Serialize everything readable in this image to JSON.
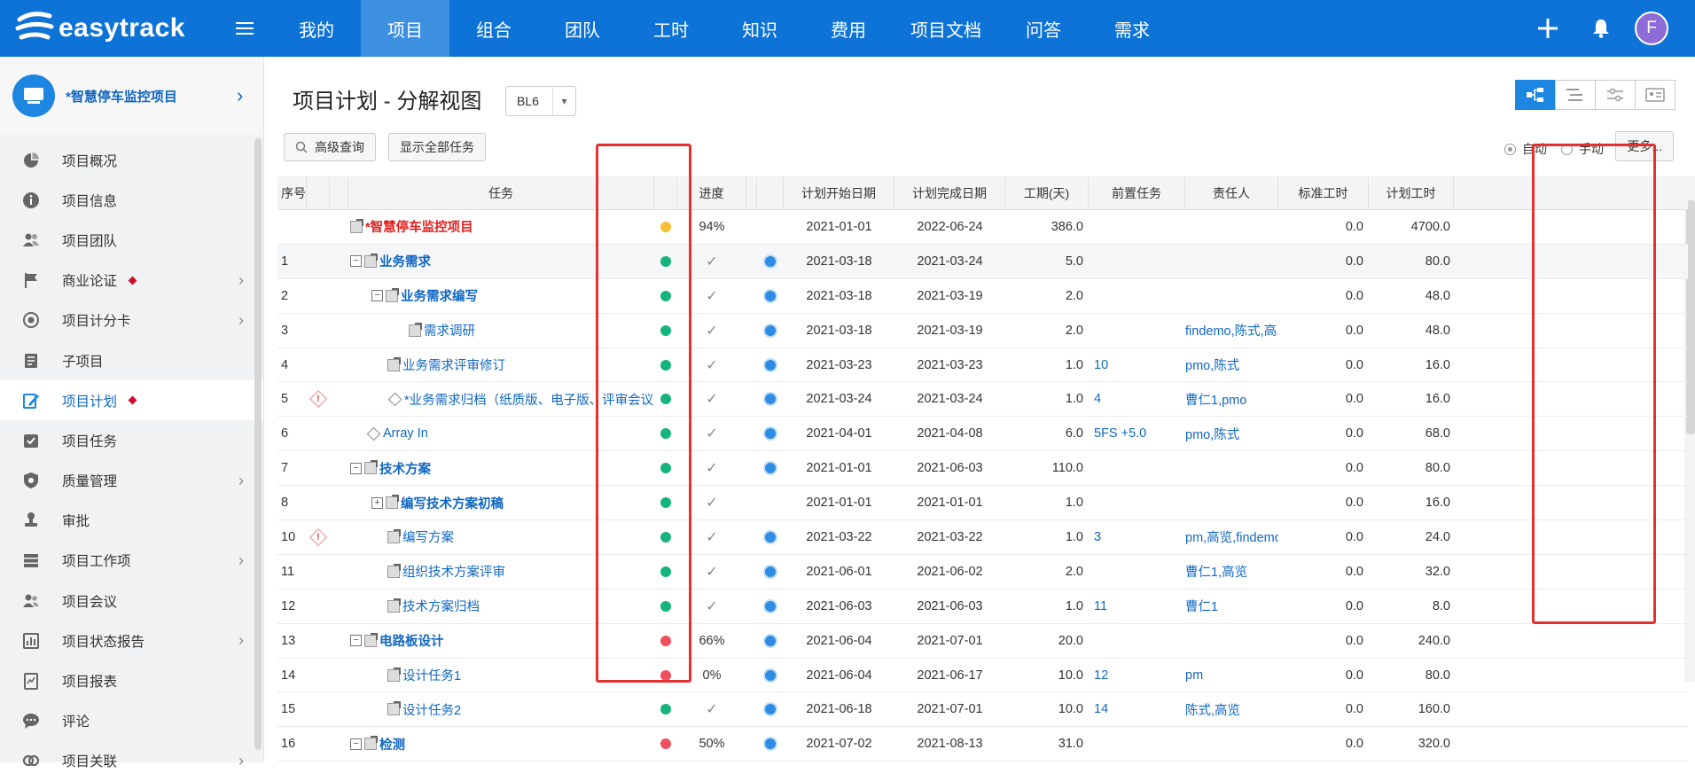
{
  "app": {
    "brand": "easytrack",
    "avatar_letter": "F"
  },
  "nav": [
    "我的",
    "项目",
    "组合",
    "团队",
    "工时",
    "知识",
    "费用",
    "项目文档",
    "问答",
    "需求"
  ],
  "nav_active": 1,
  "project": {
    "name": "*智慧停车监控项目"
  },
  "sidebar": [
    {
      "label": "项目概况",
      "icon": "pie-chart-icon"
    },
    {
      "label": "项目信息",
      "icon": "info-icon"
    },
    {
      "label": "项目团队",
      "icon": "team-icon"
    },
    {
      "label": "商业论证",
      "icon": "flag-icon",
      "chevron": true,
      "dot": true
    },
    {
      "label": "项目计分卡",
      "icon": "target-icon",
      "chevron": true
    },
    {
      "label": "子项目",
      "icon": "document-icon"
    },
    {
      "label": "项目计划",
      "icon": "edit-plan-icon",
      "dot": true,
      "active": true
    },
    {
      "label": "项目任务",
      "icon": "task-check-icon"
    },
    {
      "label": "质量管理",
      "icon": "shield-icon",
      "chevron": true
    },
    {
      "label": "审批",
      "icon": "stamp-icon"
    },
    {
      "label": "项目工作项",
      "icon": "stack-icon",
      "chevron": true
    },
    {
      "label": "项目会议",
      "icon": "meeting-icon"
    },
    {
      "label": "项目状态报告",
      "icon": "bar-report-icon",
      "chevron": true
    },
    {
      "label": "项目报表",
      "icon": "chart-report-icon"
    },
    {
      "label": "评论",
      "icon": "comment-icon"
    },
    {
      "label": "项目关联",
      "icon": "link-icon",
      "chevron": true
    }
  ],
  "page": {
    "title": "项目计划 - 分解视图",
    "baseline": "BL6",
    "advanced_search": "高级查询",
    "show_all": "显示全部任务",
    "mode_auto": "自动",
    "mode_manual": "手动",
    "more": "更多..."
  },
  "table": {
    "headers": {
      "seq": "序号",
      "task": "任务",
      "progress": "进度",
      "start": "计划开始日期",
      "end": "计划完成日期",
      "duration": "工期(天)",
      "predecessor": "前置任务",
      "owner": "责任人",
      "std_hours": "标准工时",
      "plan_hours": "计划工时"
    },
    "rows": [
      {
        "seq": "",
        "level": 0,
        "name": "*智慧停车监控项目",
        "kind": "root",
        "status": "yellow",
        "progress": "94%",
        "type_icon": false,
        "start": "2021-01-01",
        "end": "2022-06-24",
        "duration": "386.0",
        "pred": "",
        "owner": "",
        "std": "0.0",
        "plan": "4700.0"
      },
      {
        "seq": "1",
        "level": 1,
        "name": "业务需求",
        "kind": "group",
        "tree": "minus",
        "status": "green",
        "progress": "✓",
        "type_icon": true,
        "start": "2021-03-18",
        "end": "2021-03-24",
        "duration": "5.0",
        "pred": "",
        "owner": "",
        "std": "0.0",
        "plan": "80.0",
        "alt": true
      },
      {
        "seq": "2",
        "level": 2,
        "name": "业务需求编写",
        "kind": "group",
        "tree": "minus",
        "status": "green",
        "progress": "✓",
        "type_icon": true,
        "start": "2021-03-18",
        "end": "2021-03-19",
        "duration": "2.0",
        "pred": "",
        "owner": "",
        "std": "0.0",
        "plan": "48.0"
      },
      {
        "seq": "3",
        "level": 3,
        "name": "需求调研",
        "kind": "task",
        "status": "green",
        "progress": "✓",
        "type_icon": true,
        "start": "2021-03-18",
        "end": "2021-03-19",
        "duration": "2.0",
        "pred": "",
        "owner": "findemo,陈式,高...",
        "std": "0.0",
        "plan": "48.0"
      },
      {
        "seq": "4",
        "level": 2,
        "name": "业务需求评审修订",
        "kind": "task",
        "status": "green",
        "progress": "✓",
        "type_icon": true,
        "start": "2021-03-23",
        "end": "2021-03-23",
        "duration": "1.0",
        "pred": "10",
        "owner": "pmo,陈式",
        "std": "0.0",
        "plan": "16.0"
      },
      {
        "seq": "5",
        "level": 2,
        "name": "*业务需求归档（纸质版、电子版、评审会议纪",
        "kind": "milestone",
        "warn": true,
        "status": "green",
        "progress": "✓",
        "type_icon": true,
        "start": "2021-03-24",
        "end": "2021-03-24",
        "duration": "1.0",
        "pred": "4",
        "owner": "曹仁1,pmo",
        "std": "0.0",
        "plan": "16.0"
      },
      {
        "seq": "6",
        "level": 1,
        "name": "Array In",
        "kind": "milestone",
        "status": "green",
        "progress": "✓",
        "type_icon": true,
        "start": "2021-04-01",
        "end": "2021-04-08",
        "duration": "6.0",
        "pred": "5FS +5.0",
        "owner": "pmo,陈式",
        "std": "0.0",
        "plan": "68.0"
      },
      {
        "seq": "7",
        "level": 1,
        "name": "技术方案",
        "kind": "group",
        "tree": "minus",
        "status": "green",
        "progress": "✓",
        "type_icon": true,
        "start": "2021-01-01",
        "end": "2021-06-03",
        "duration": "110.0",
        "pred": "",
        "owner": "",
        "std": "0.0",
        "plan": "80.0"
      },
      {
        "seq": "8",
        "level": 2,
        "name": "编写技术方案初稿",
        "kind": "group",
        "tree": "plus",
        "status": "green",
        "progress": "✓",
        "type_icon": false,
        "start": "2021-01-01",
        "end": "2021-01-01",
        "duration": "1.0",
        "pred": "",
        "owner": "",
        "std": "0.0",
        "plan": "16.0"
      },
      {
        "seq": "10",
        "level": 2,
        "name": "编写方案",
        "kind": "task",
        "warn": true,
        "status": "green",
        "progress": "✓",
        "type_icon": true,
        "start": "2021-03-22",
        "end": "2021-03-22",
        "duration": "1.0",
        "pred": "3",
        "owner": "pm,高览,findemo",
        "std": "0.0",
        "plan": "24.0"
      },
      {
        "seq": "11",
        "level": 2,
        "name": "组织技术方案评审",
        "kind": "task",
        "status": "green",
        "progress": "✓",
        "type_icon": true,
        "start": "2021-06-01",
        "end": "2021-06-02",
        "duration": "2.0",
        "pred": "",
        "owner": "曹仁1,高览",
        "std": "0.0",
        "plan": "32.0"
      },
      {
        "seq": "12",
        "level": 2,
        "name": "技术方案归档",
        "kind": "task",
        "status": "green",
        "progress": "✓",
        "type_icon": true,
        "start": "2021-06-03",
        "end": "2021-06-03",
        "duration": "1.0",
        "pred": "11",
        "owner": "曹仁1",
        "std": "0.0",
        "plan": "8.0"
      },
      {
        "seq": "13",
        "level": 1,
        "name": "电路板设计",
        "kind": "group",
        "tree": "minus",
        "status": "red",
        "progress": "66%",
        "type_icon": true,
        "start": "2021-06-04",
        "end": "2021-07-01",
        "duration": "20.0",
        "pred": "",
        "owner": "",
        "std": "0.0",
        "plan": "240.0"
      },
      {
        "seq": "14",
        "level": 2,
        "name": "设计任务1",
        "kind": "task",
        "status": "red",
        "progress": "0%",
        "type_icon": true,
        "start": "2021-06-04",
        "end": "2021-06-17",
        "duration": "10.0",
        "pred": "12",
        "owner": "pm",
        "std": "0.0",
        "plan": "80.0"
      },
      {
        "seq": "15",
        "level": 2,
        "name": "设计任务2",
        "kind": "task",
        "status": "green",
        "progress": "✓",
        "type_icon": true,
        "start": "2021-06-18",
        "end": "2021-07-01",
        "duration": "10.0",
        "pred": "14",
        "owner": "陈式,高览",
        "std": "0.0",
        "plan": "160.0"
      },
      {
        "seq": "16",
        "level": 1,
        "name": "检测",
        "kind": "group",
        "tree": "minus",
        "status": "red",
        "progress": "50%",
        "type_icon": true,
        "start": "2021-07-02",
        "end": "2021-08-13",
        "duration": "31.0",
        "pred": "",
        "owner": "",
        "std": "0.0",
        "plan": "320.0"
      }
    ]
  },
  "colors": {
    "brand": "#0d73d6",
    "green": "#16b47d",
    "red": "#f04f5e",
    "yellow": "#f5c033",
    "highlight": "#e53030"
  }
}
